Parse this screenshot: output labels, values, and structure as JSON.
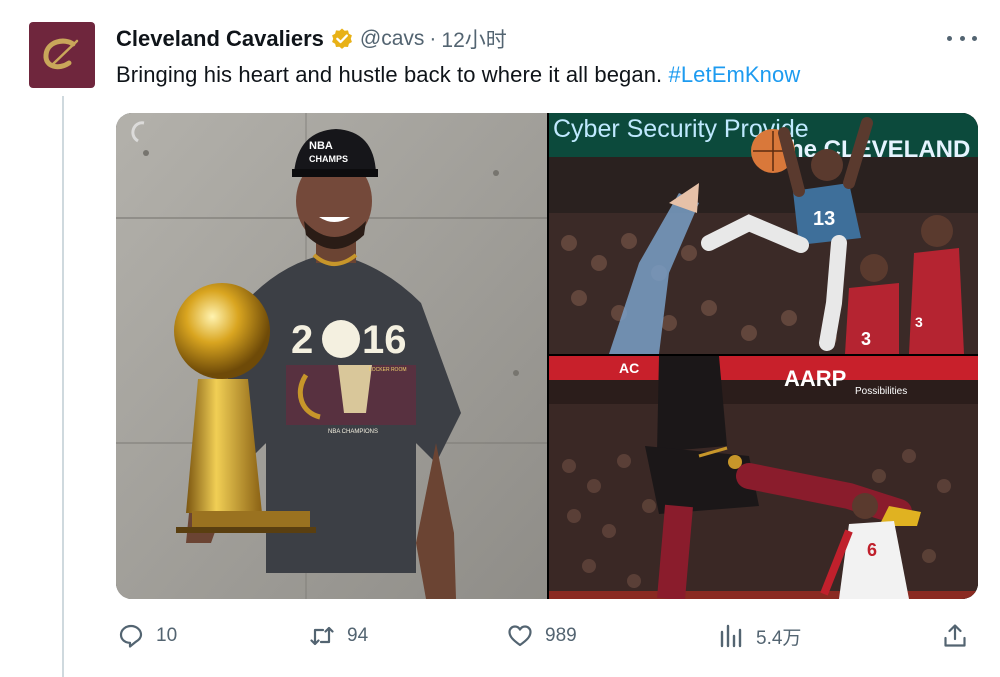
{
  "tweet": {
    "display_name": "Cleveland Cavaliers",
    "handle": "@cavs",
    "separator": "·",
    "time": "12小时",
    "text": "Bringing his heart and hustle back to where it all began. ",
    "hashtag": "#LetEmKnow",
    "avatar_icon": "cavs-c-logo-icon",
    "verified_icon": "verified-gold-badge-icon"
  },
  "media": {
    "photo1_texts": {
      "cap_line1": "NBA",
      "cap_line2": "CHAMPS",
      "year_left": "2",
      "year_right": "16",
      "shirt_small_1": "LOCKER ROOM",
      "shirt_small_2": "NBA CHAMPIONS"
    },
    "photo2_texts": {
      "banner": "Cyber Security Provide",
      "banner2": "the CLEVELAND CAVALIE",
      "jersey_number": "13",
      "defender_number": "3",
      "defender_number_2": "3"
    },
    "photo3_texts": {
      "board_left": "AC",
      "sponsor": "AARP",
      "sponsor_sub": "Possibilities",
      "defender_number": "6"
    }
  },
  "actions": {
    "reply_count": "10",
    "retweet_count": "94",
    "like_count": "989",
    "views_count": "5.4万",
    "icons": [
      "reply-icon",
      "retweet-icon",
      "like-icon",
      "views-icon",
      "share-icon"
    ]
  },
  "colors": {
    "cavs_wine": "#6f263d",
    "cavs_gold": "#ffb81c",
    "link_blue": "#1d9bf0",
    "muted_gray": "#536471"
  }
}
